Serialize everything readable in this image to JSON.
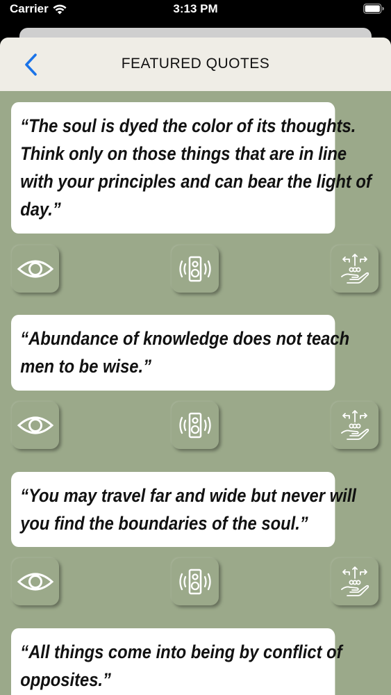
{
  "status_bar": {
    "carrier": "Carrier",
    "time": "3:13 PM"
  },
  "nav": {
    "title": "FEATURED QUOTES"
  },
  "colors": {
    "background": "#9ba98a",
    "nav_bar": "#efede6",
    "accent": "#1a73e8",
    "card": "#ffffff"
  },
  "quotes": [
    {
      "text": "“The soul is dyed the color of its thoughts. Think only on those things that are in line with your principles and can bear the light of day.”"
    },
    {
      "text": "“Abundance of knowledge does not teach men to be wise.”"
    },
    {
      "text": "“You may travel far and wide but never will you find the boundaries of the soul.”"
    },
    {
      "text": "“All things come into being by conflict of opposites.”"
    }
  ],
  "actions": {
    "view_icon": "eye-icon",
    "speak_icon": "speaker-icon",
    "share_icon": "hand-share-icon"
  }
}
